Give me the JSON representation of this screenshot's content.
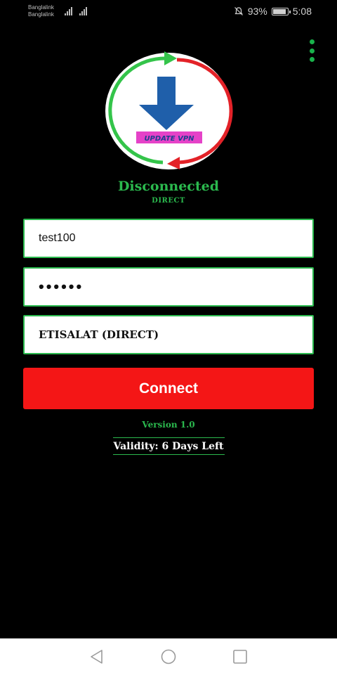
{
  "status_bar": {
    "carrier_1": "Banglalink",
    "carrier_2": "Banglalink",
    "battery_level": "93%",
    "battery_fraction": 0.93,
    "time": "5:08",
    "icons": [
      "signal-icon",
      "mute-icon",
      "battery-icon"
    ]
  },
  "logo": {
    "banner_text": "UPDATE VPN",
    "colors": {
      "green_arrow": "#34c44a",
      "red_arrow": "#e32228",
      "blue_arrow": "#1f5faa",
      "banner": "#e542c8"
    }
  },
  "connection": {
    "status": "Disconnected",
    "mode": "DIRECT"
  },
  "form": {
    "username_value": "test100",
    "password_value": "••••••",
    "server_selected": "ETISALAT (DIRECT)"
  },
  "connect_label": "Connect",
  "version_label": "Version  1.0",
  "validity_label": "Validity: 6 Days Left",
  "colors": {
    "accent_green": "#2bb94e",
    "connect_red": "#f41616",
    "background": "#000000"
  }
}
